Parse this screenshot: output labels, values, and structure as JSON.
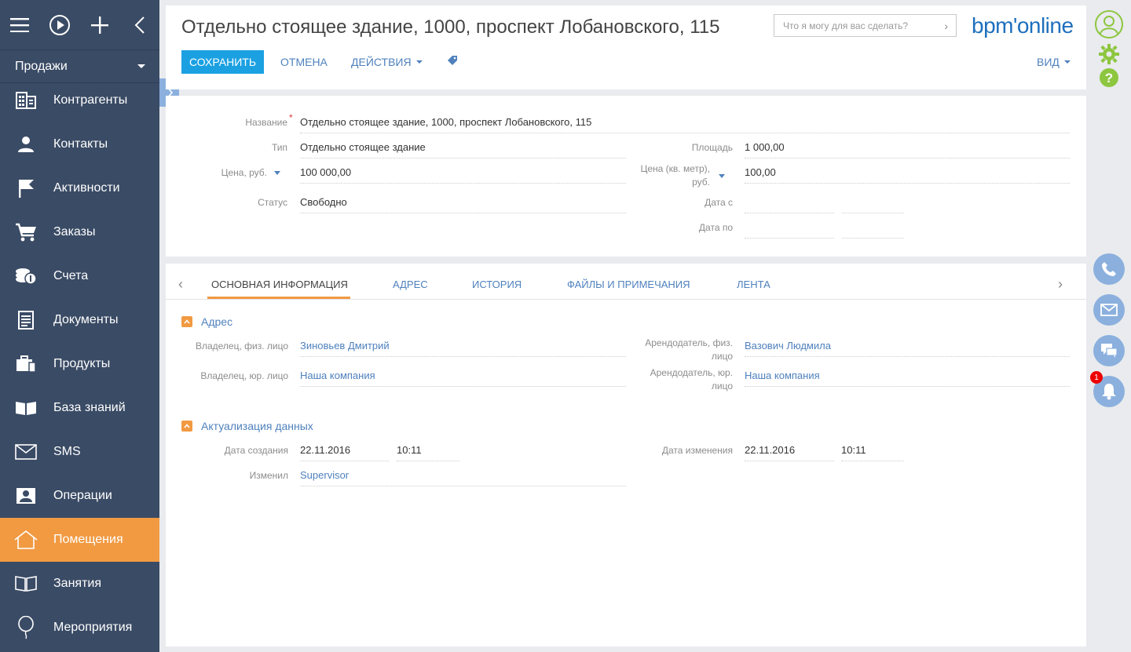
{
  "sidebar": {
    "section": "Продажи",
    "items": [
      {
        "label": "Контрагенты",
        "icon": "building-icon"
      },
      {
        "label": "Контакты",
        "icon": "person-icon"
      },
      {
        "label": "Активности",
        "icon": "flag-icon"
      },
      {
        "label": "Заказы",
        "icon": "cart-icon"
      },
      {
        "label": "Счета",
        "icon": "coins-icon"
      },
      {
        "label": "Документы",
        "icon": "document-icon"
      },
      {
        "label": "Продукты",
        "icon": "briefcase-icon"
      },
      {
        "label": "База знаний",
        "icon": "open-book-icon"
      },
      {
        "label": "SMS",
        "icon": "envelope-icon"
      },
      {
        "label": "Операции",
        "icon": "contact-card-icon"
      },
      {
        "label": "Помещения",
        "icon": "house-icon"
      },
      {
        "label": "Занятия",
        "icon": "book-icon"
      },
      {
        "label": "Мероприятия",
        "icon": "balloon-icon"
      }
    ],
    "active_index": 10
  },
  "header": {
    "title": "Отдельно стоящее здание, 1000, проспект Лобановского, 115",
    "search_placeholder": "Что я могу для вас сделать?",
    "logo": "bpm'online",
    "save_label": "СОХРАНИТЬ",
    "cancel_label": "ОТМЕНА",
    "actions_label": "ДЕЙСТВИЯ",
    "view_label": "ВИД"
  },
  "form": {
    "name_label": "Название",
    "name_value": "Отдельно стоящее здание, 1000, проспект Лобановского, 115",
    "type_label": "Тип",
    "type_value": "Отдельно стоящее здание",
    "price_label": "Цена, руб.",
    "price_value": "100 000,00",
    "status_label": "Статус",
    "status_value": "Свободно",
    "area_label": "Площадь",
    "area_value": "1 000,00",
    "price_sqm_label_1": "Цена (кв. метр),",
    "price_sqm_label_2": "руб.",
    "price_sqm_value": "100,00",
    "date_from_label": "Дата с",
    "date_to_label": "Дата по"
  },
  "tabs": {
    "items": [
      "ОСНОВНАЯ ИНФОРМАЦИЯ",
      "АДРЕС",
      "ИСТОРИЯ",
      "ФАЙЛЫ И ПРИМЕЧАНИЯ",
      "ЛЕНТА"
    ],
    "active_index": 0
  },
  "groups": {
    "address": {
      "title": "Адрес",
      "owner_person_label": "Владелец, физ. лицо",
      "owner_person_value": "Зиновьев Дмитрий",
      "owner_company_label": "Владелец, юр. лицо",
      "owner_company_value": "Наша компания",
      "tenant_person_label_1": "Арендодатель, физ.",
      "tenant_person_label_2": "лицо",
      "tenant_person_value": "Вазович Людмила",
      "tenant_company_label_1": "Арендодатель, юр.",
      "tenant_company_label_2": "лицо",
      "tenant_company_value": "Наша компания"
    },
    "update": {
      "title": "Актуализация данных",
      "created_label": "Дата создания",
      "created_date": "22.11.2016",
      "created_time": "10:11",
      "modified_label": "Дата изменения",
      "modified_date": "22.11.2016",
      "modified_time": "10:11",
      "modified_by_label": "Изменил",
      "modified_by_value": "Supervisor"
    }
  },
  "rightbar": {
    "notifications_count": "1"
  },
  "colors": {
    "sidebar": "#3a4b65",
    "accent": "#f19a42",
    "primary": "#1ba1e2",
    "link": "#4f81bd",
    "rightbar_icon": "#8bb0de"
  }
}
